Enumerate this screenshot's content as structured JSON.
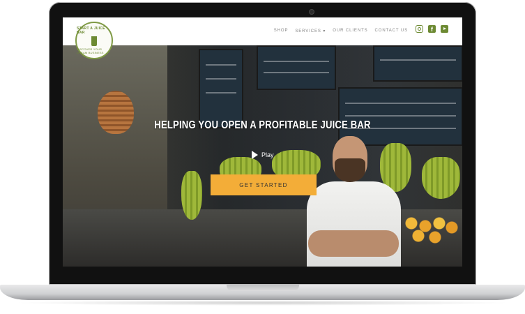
{
  "brand": {
    "logo_top": "START A JUICE BAR",
    "logo_bottom": "DISCOVER YOUR DREAM BUSINESS"
  },
  "nav": {
    "items": [
      "SHOP",
      "SERVICES ▾",
      "OUR CLIENTS",
      "CONTACT US"
    ]
  },
  "social": [
    "instagram-icon",
    "facebook-icon",
    "youtube-icon"
  ],
  "hero": {
    "headline": "HELPING YOU OPEN A PROFITABLE JUICE BAR",
    "play_label": "Play",
    "cta_label": "GET STARTED"
  },
  "colors": {
    "accent_green": "#6d8a33",
    "cta_orange": "#f3ad38"
  }
}
